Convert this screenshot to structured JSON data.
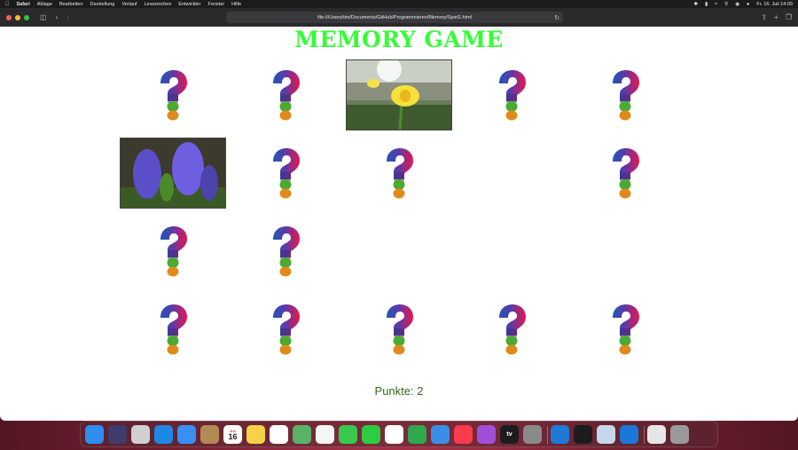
{
  "menubar": {
    "app": "Safari",
    "items": [
      "Ablage",
      "Bearbeiten",
      "Darstellung",
      "Verlauf",
      "Lesezeichen",
      "Entwickler",
      "Fenster",
      "Hilfe"
    ],
    "clock": "Fr. 16. Juli  14:09"
  },
  "browser": {
    "url": "file:///Users/tim/Documents/GitHub/Programmieren/Memory/Spiel1.html"
  },
  "page": {
    "title": "MEMORY GAME",
    "score_label": "Punkte: 2"
  },
  "cards": [
    {
      "state": "hidden"
    },
    {
      "state": "hidden"
    },
    {
      "state": "daffodil"
    },
    {
      "state": "hidden"
    },
    {
      "state": "hidden"
    },
    {
      "state": "hyacinth"
    },
    {
      "state": "hidden"
    },
    {
      "state": "hidden"
    },
    {
      "state": "removed"
    },
    {
      "state": "hidden"
    },
    {
      "state": "hidden"
    },
    {
      "state": "hidden"
    },
    {
      "state": "removed"
    },
    {
      "state": "removed"
    },
    {
      "state": "removed"
    },
    {
      "state": "hidden"
    },
    {
      "state": "hidden"
    },
    {
      "state": "hidden"
    },
    {
      "state": "hidden"
    },
    {
      "state": "hidden"
    }
  ],
  "dock": {
    "icons": [
      "finder-icon",
      "siri-icon",
      "launchpad-icon",
      "safari-icon",
      "mail-icon",
      "contacts-icon",
      "calendar-icon",
      "notes-icon",
      "reminders-icon",
      "maps-icon",
      "photos-icon",
      "messages-icon",
      "facetime-icon",
      "freeform-icon",
      "numbers-icon",
      "keynote-icon",
      "music-icon",
      "podcasts-icon",
      "appletv-icon",
      "settings-icon",
      "vscode-icon",
      "terminal-icon",
      "preview-icon",
      "xcode-icon",
      "downloads-icon",
      "trash-icon"
    ],
    "calendar_day": "16",
    "calendar_month": "JUL",
    "appletv_label": "tv"
  }
}
